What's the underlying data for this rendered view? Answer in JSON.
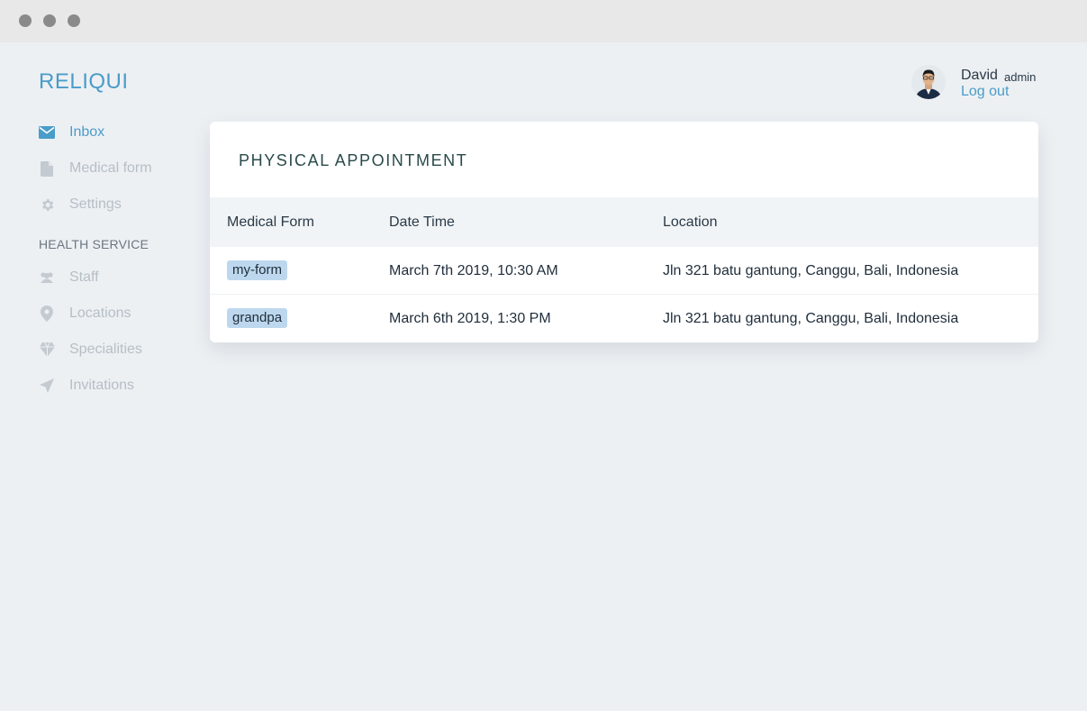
{
  "app": {
    "brand": "RELIQUI"
  },
  "sidebar": {
    "items": [
      {
        "label": "Inbox",
        "icon": "mail-icon"
      },
      {
        "label": "Medical form",
        "icon": "file-icon"
      },
      {
        "label": "Settings",
        "icon": "gear-icon"
      }
    ],
    "section_title": "HEALTH SERVICE",
    "service_items": [
      {
        "label": "Staff",
        "icon": "people-icon"
      },
      {
        "label": "Locations",
        "icon": "map-pin-icon"
      },
      {
        "label": "Specialities",
        "icon": "diamond-icon"
      },
      {
        "label": "Invitations",
        "icon": "send-icon"
      }
    ]
  },
  "user": {
    "name": "David",
    "role": "admin",
    "logout_label": "Log out"
  },
  "card": {
    "title": "PHYSICAL APPOINTMENT",
    "columns": [
      "Medical Form",
      "Date Time",
      "Location"
    ],
    "rows": [
      {
        "form": "my-form",
        "datetime": "March 7th 2019, 10:30 AM",
        "location": "Jln 321 batu gantung, Canggu, Bali, Indonesia"
      },
      {
        "form": "grandpa",
        "datetime": "March 6th 2019, 1:30 PM",
        "location": "Jln 321 batu gantung, Canggu, Bali, Indonesia"
      }
    ]
  },
  "colors": {
    "accent": "#4a9cc9",
    "background": "#edf0f3",
    "tag": "#bdd8ee",
    "muted": "#b6bec6"
  }
}
